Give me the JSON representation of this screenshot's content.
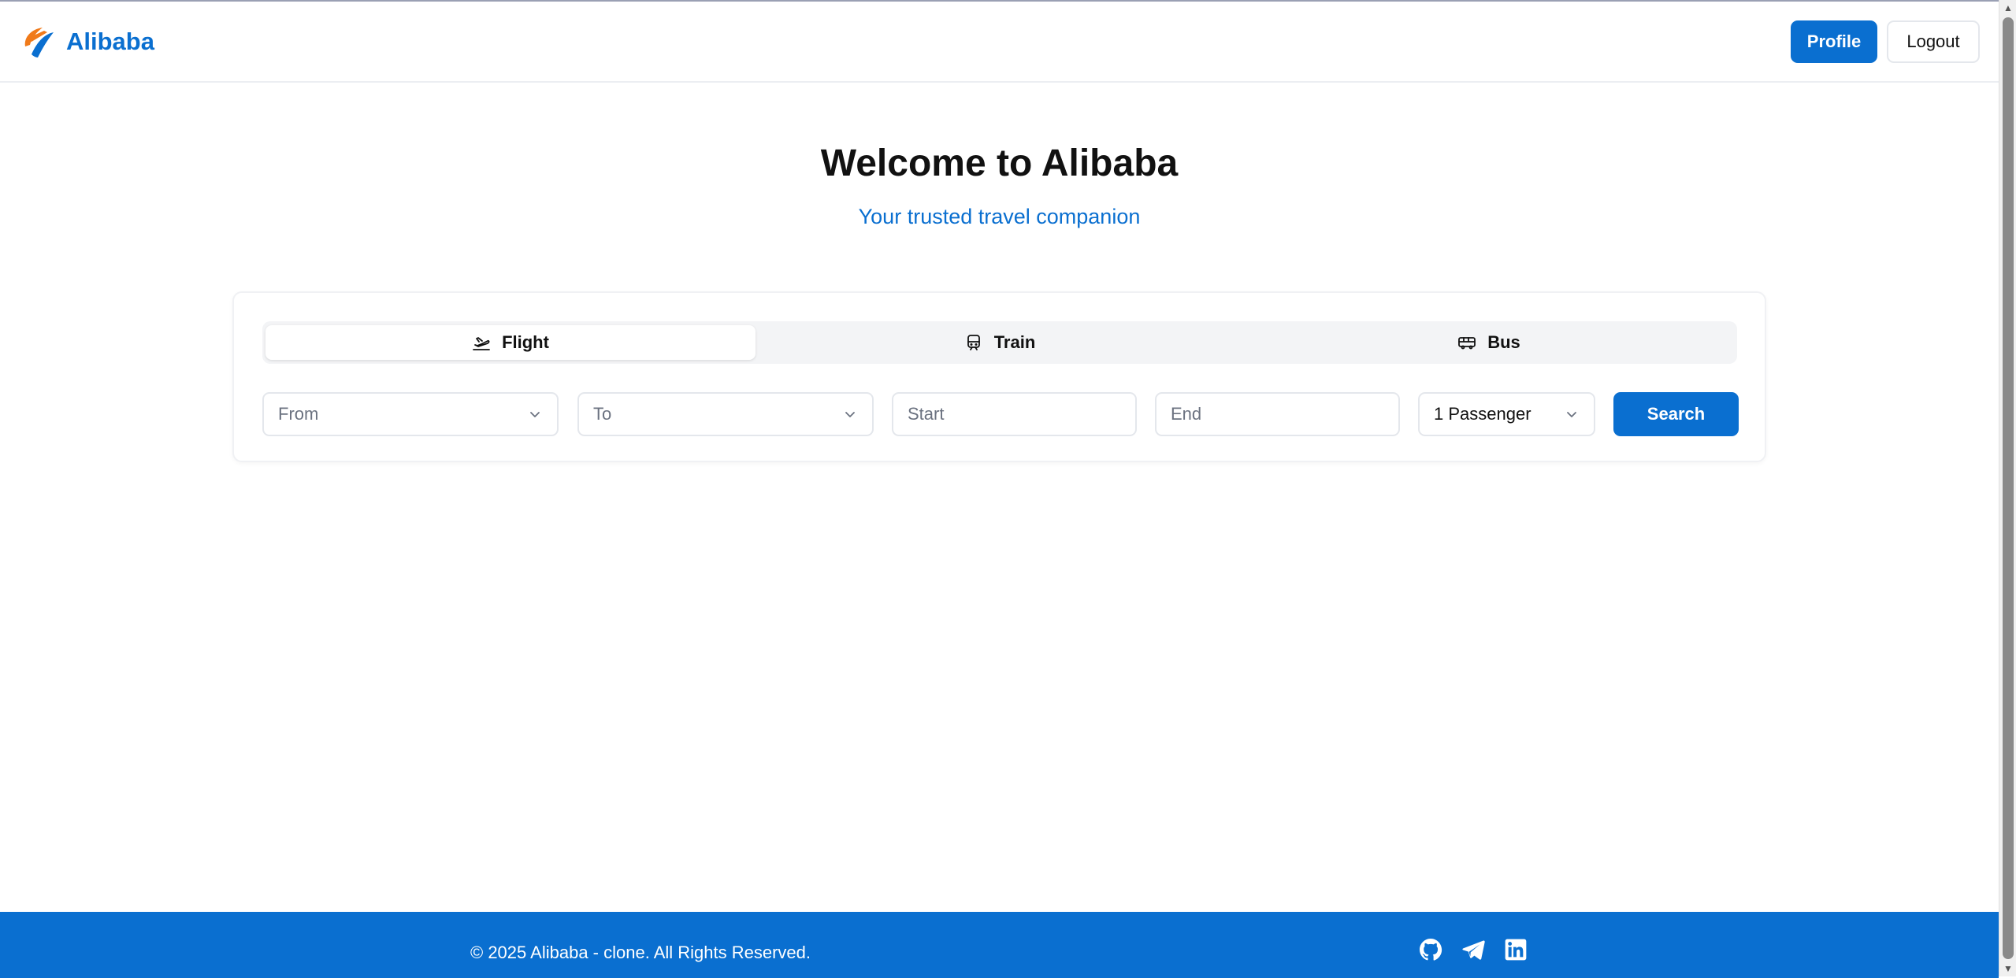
{
  "header": {
    "brand_name": "Alibaba",
    "profile_label": "Profile",
    "logout_label": "Logout"
  },
  "hero": {
    "title": "Welcome to Alibaba",
    "subtitle": "Your trusted travel companion"
  },
  "search": {
    "tabs": [
      {
        "label": "Flight",
        "icon": "plane-departure-icon",
        "active": true
      },
      {
        "label": "Train",
        "icon": "train-icon",
        "active": false
      },
      {
        "label": "Bus",
        "icon": "bus-icon",
        "active": false
      }
    ],
    "from_placeholder": "From",
    "to_placeholder": "To",
    "start_placeholder": "Start",
    "end_placeholder": "End",
    "passengers_value": "1 Passenger",
    "search_label": "Search"
  },
  "footer": {
    "copyright": "© 2025 Alibaba - clone. All Rights Reserved.",
    "social": [
      "github-icon",
      "telegram-icon",
      "linkedin-icon"
    ]
  },
  "colors": {
    "primary": "#0a6fd0",
    "logo_orange": "#f07a1a"
  }
}
